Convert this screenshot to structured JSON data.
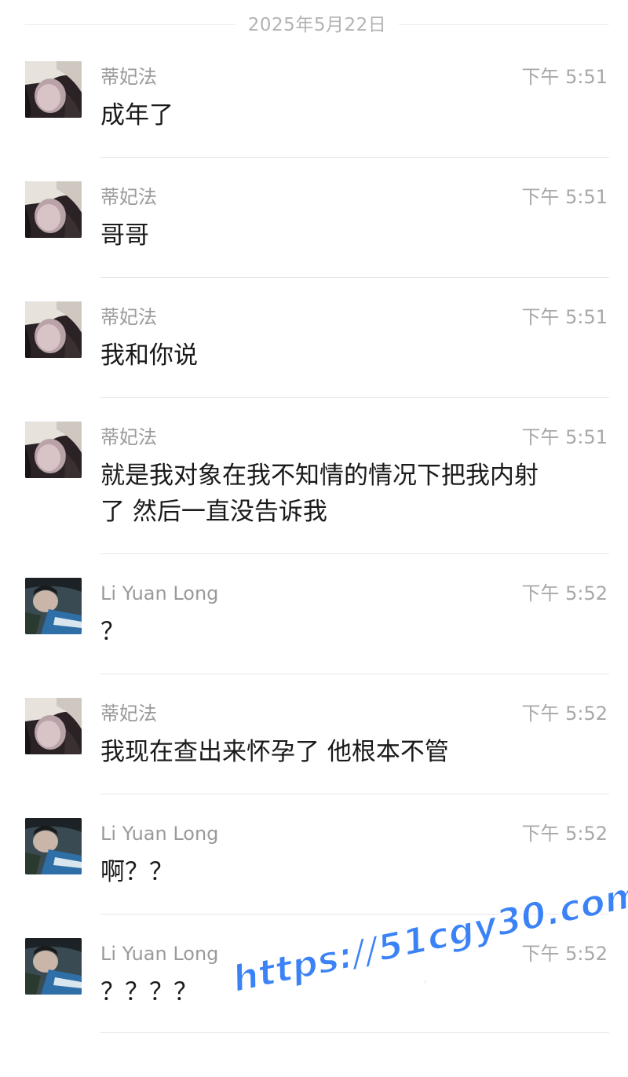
{
  "date_separator": "2025年5月22日",
  "messages": [
    {
      "sender": "蒂妃法",
      "time": "下午 5:51",
      "text": "成年了",
      "avatar": "woman-avatar"
    },
    {
      "sender": "蒂妃法",
      "time": "下午 5:51",
      "text": "哥哥",
      "avatar": "woman-avatar"
    },
    {
      "sender": "蒂妃法",
      "time": "下午 5:51",
      "text": "我和你说",
      "avatar": "woman-avatar"
    },
    {
      "sender": "蒂妃法",
      "time": "下午 5:51",
      "text": "就是我对象在我不知情的情况下把我内射\n了 然后一直没告诉我",
      "avatar": "woman-avatar"
    },
    {
      "sender": "Li Yuan Long",
      "time": "下午 5:52",
      "text": "？",
      "avatar": "man-avatar"
    },
    {
      "sender": "蒂妃法",
      "time": "下午 5:52",
      "text": "我现在查出来怀孕了 他根本不管",
      "avatar": "woman-avatar"
    },
    {
      "sender": "Li Yuan Long",
      "time": "下午 5:52",
      "text": "啊？？",
      "avatar": "man-avatar"
    },
    {
      "sender": "Li Yuan Long",
      "time": "下午 5:52",
      "text": "？？？？",
      "avatar": "man-avatar"
    }
  ],
  "watermark": {
    "url": "https://51cgy30.com",
    "subtitle": "看完整版"
  },
  "colors": {
    "watermark": "#3b82f6",
    "sender": "#9a9a9a",
    "time": "#a8a8a8",
    "message_text": "#1a1a1a",
    "divider": "#e8e8e8"
  }
}
